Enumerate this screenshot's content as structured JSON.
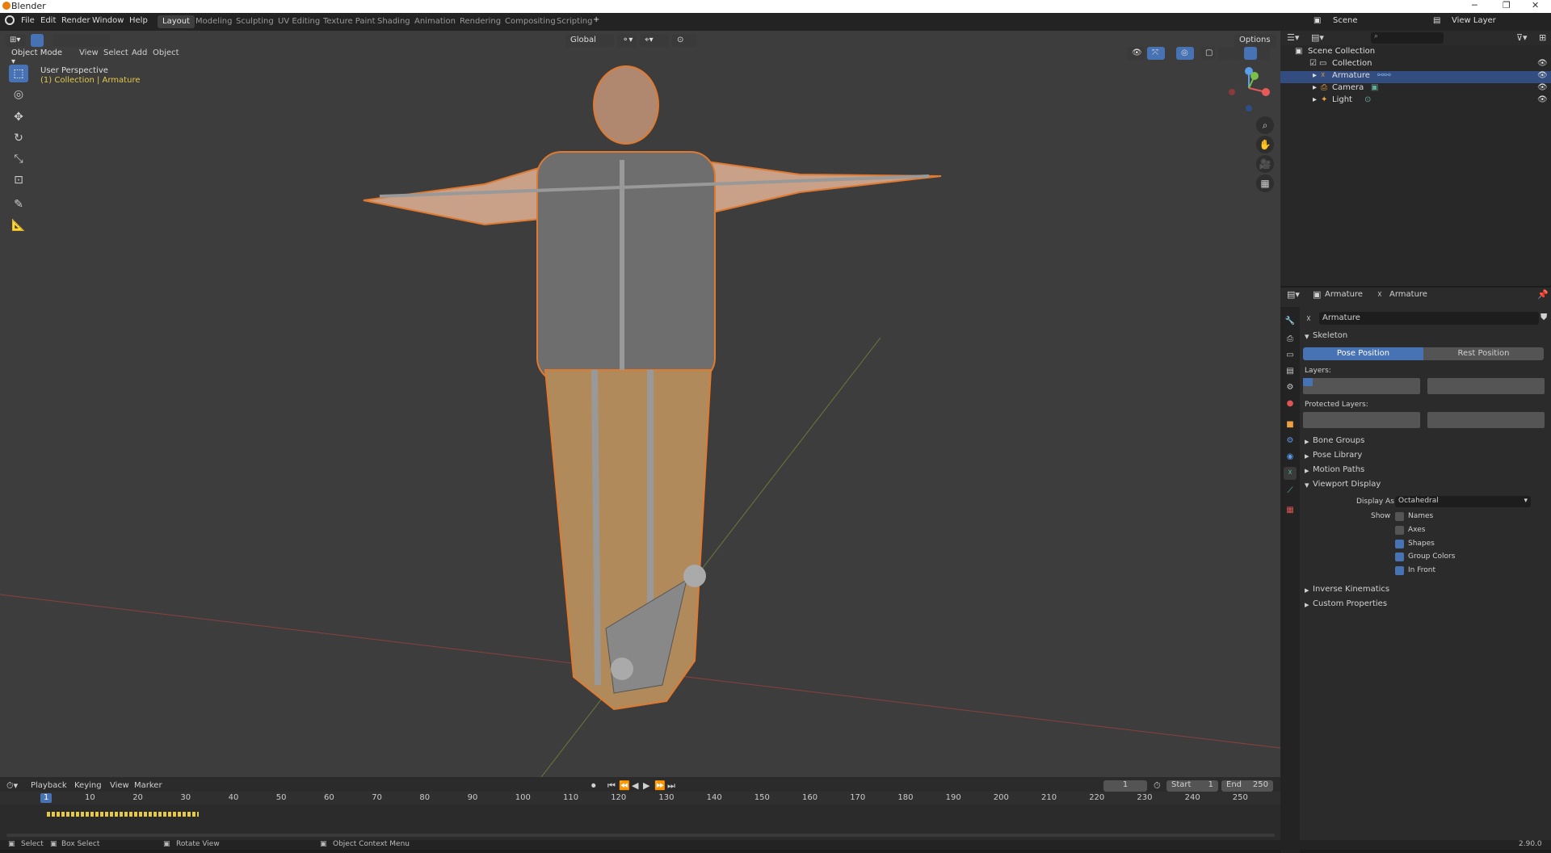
{
  "window": {
    "title": "Blender"
  },
  "menu": {
    "file": "File",
    "edit": "Edit",
    "render": "Render",
    "window": "Window",
    "help": "Help"
  },
  "workspaces": [
    "Layout",
    "Modeling",
    "Sculpting",
    "UV Editing",
    "Texture Paint",
    "Shading",
    "Animation",
    "Rendering",
    "Compositing",
    "Scripting"
  ],
  "scene": {
    "name": "Scene",
    "view_layer": "View Layer"
  },
  "viewport": {
    "mode": "Object Mode",
    "view": "View",
    "select": "Select",
    "add": "Add",
    "object": "Object",
    "orientation": "Global",
    "options": "Options",
    "perspective": "User Perspective",
    "collection_info": "(1) Collection | Armature"
  },
  "outliner": {
    "search_placeholder": "",
    "rows": [
      {
        "label": "Scene Collection"
      },
      {
        "label": "Collection"
      },
      {
        "label": "Armature"
      },
      {
        "label": "Camera"
      },
      {
        "label": "Light"
      }
    ]
  },
  "properties": {
    "breadcrumb_object": "Armature",
    "breadcrumb_data": "Armature",
    "data_name": "Armature",
    "skeleton": "Skeleton",
    "pose_position": "Pose Position",
    "rest_position": "Rest Position",
    "layers": "Layers:",
    "protected_layers": "Protected Layers:",
    "bone_groups": "Bone Groups",
    "pose_library": "Pose Library",
    "motion_paths": "Motion Paths",
    "viewport_display": "Viewport Display",
    "display_as_label": "Display As",
    "display_as_value": "Octahedral",
    "show_label": "Show",
    "show_names": "Names",
    "show_axes": "Axes",
    "show_shapes": "Shapes",
    "show_group_colors": "Group Colors",
    "show_in_front": "In Front",
    "inverse_kinematics": "Inverse Kinematics",
    "custom_properties": "Custom Properties"
  },
  "timeline": {
    "playback": "Playback",
    "keying": "Keying",
    "view": "View",
    "marker": "Marker",
    "current_frame": "1",
    "start_label": "Start",
    "start": "1",
    "end_label": "End",
    "end": "250",
    "ticks": [
      "1",
      "10",
      "20",
      "30",
      "40",
      "50",
      "60",
      "70",
      "80",
      "90",
      "100",
      "110",
      "120",
      "130",
      "140",
      "150",
      "160",
      "170",
      "180",
      "190",
      "200",
      "210",
      "220",
      "230",
      "240",
      "250"
    ]
  },
  "statusbar": {
    "select": "Select",
    "box_select": "Box Select",
    "rotate_view": "Rotate View",
    "context_menu": "Object Context Menu",
    "version": "2.90.0"
  }
}
